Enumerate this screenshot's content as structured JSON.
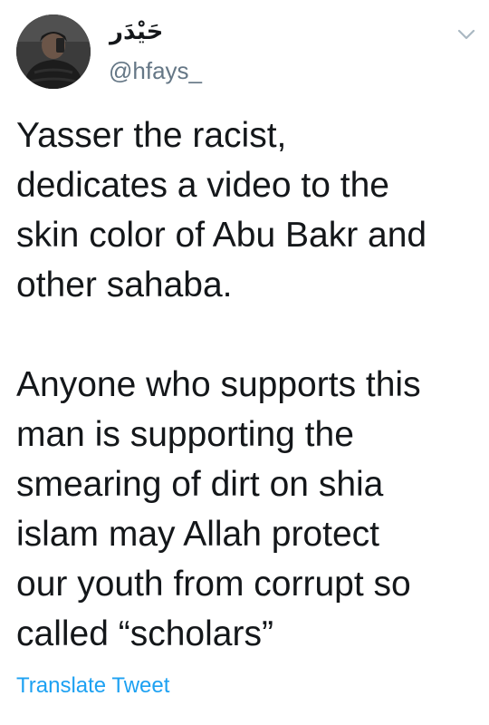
{
  "tweet": {
    "display_name": "حَيْدَر",
    "handle": "@hfays_",
    "paragraphs": [
      {
        "lines": [
          "Yasser the racist,",
          "dedicates a video to the",
          "skin color of Abu Bakr and",
          "other sahaba."
        ]
      },
      {
        "lines": [
          "Anyone who supports this",
          "man is supporting the",
          "smearing of dirt on shia",
          "islam may Allah protect",
          "our youth from corrupt so",
          "called “scholars”"
        ]
      }
    ],
    "translate_label": "Translate Tweet",
    "menu_icon": "chevron-down-icon",
    "colors": {
      "text": "#14171a",
      "secondary": "#657786",
      "link": "#1da1f2"
    }
  }
}
